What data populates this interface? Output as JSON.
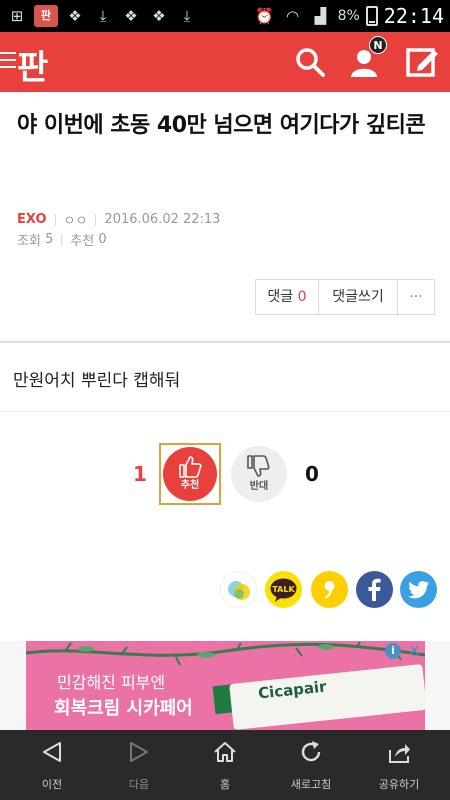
{
  "status_bar": {
    "app_icon_label": "판",
    "battery_pct": "8%",
    "time": "22:14"
  },
  "header": {
    "logo": "판",
    "notification_badge": "N",
    "accent_color": "#e8413d"
  },
  "article": {
    "title": "야 이번에 초동 40만 넘으면 여기다가 깊티콘",
    "category": "EXO",
    "author": "ㅇㅇ",
    "date": "2016.06.02 22:13",
    "views_label": "조회",
    "views": "5",
    "recommends_label": "추천",
    "recommends": "0",
    "body": "만원어치 뿌린다 캡해둬"
  },
  "comments": {
    "label": "댓글",
    "count": "0",
    "write_label": "댓글쓰기",
    "more_label": "···"
  },
  "votes": {
    "up_count": "1",
    "up_label": "추천",
    "down_count": "0",
    "down_label": "반대"
  },
  "share": {
    "kakao_talk": "TALK"
  },
  "ad": {
    "line1": "민감해진 피부엔",
    "line2": "회복크림 시카페어",
    "brand": "Cicapair",
    "info": "i",
    "close": "✕"
  },
  "bottom_nav": {
    "items": [
      {
        "label": "이전"
      },
      {
        "label": "다음"
      },
      {
        "label": "홈"
      },
      {
        "label": "새로고침"
      },
      {
        "label": "공유하기"
      }
    ]
  }
}
